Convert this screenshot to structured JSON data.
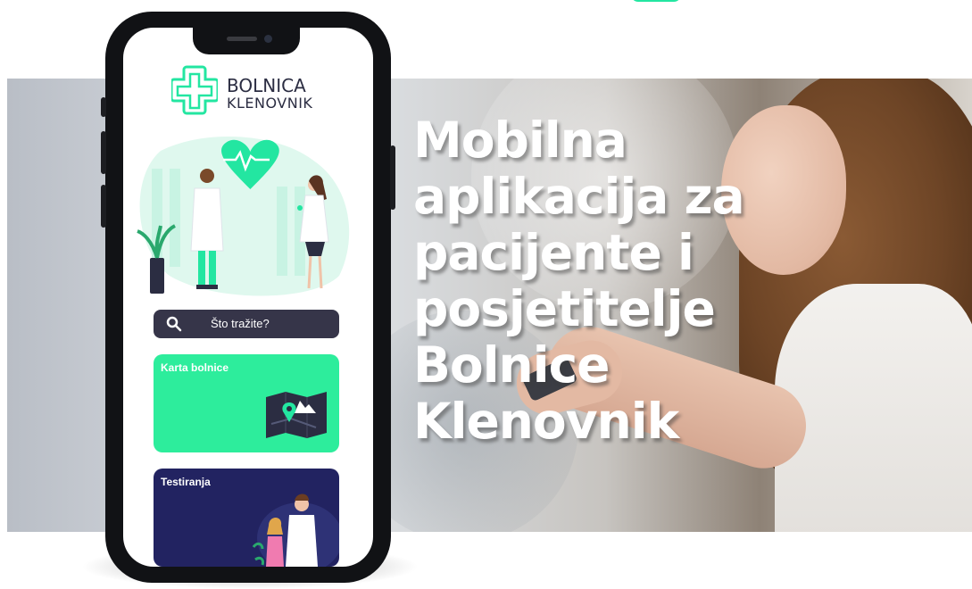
{
  "headline": {
    "lines": [
      "Mobilna",
      "aplikacija za",
      "pacijente i",
      "posjetitelje",
      "Bolnice",
      "Klenovnik"
    ]
  },
  "app": {
    "logo_line1": "BOLNICA",
    "logo_line2": "KLENOVNIK",
    "search_placeholder": "Što tražite?",
    "cards": [
      {
        "title": "Karta bolnice",
        "color": "#2DED9C",
        "icon": "map-icon"
      },
      {
        "title": "Testiranja",
        "color": "#222361",
        "icon": "doctor-child-illustration"
      }
    ]
  },
  "colors": {
    "accent": "#23E6A1",
    "text_dark": "#2B2D42",
    "search_bg": "#363549"
  }
}
